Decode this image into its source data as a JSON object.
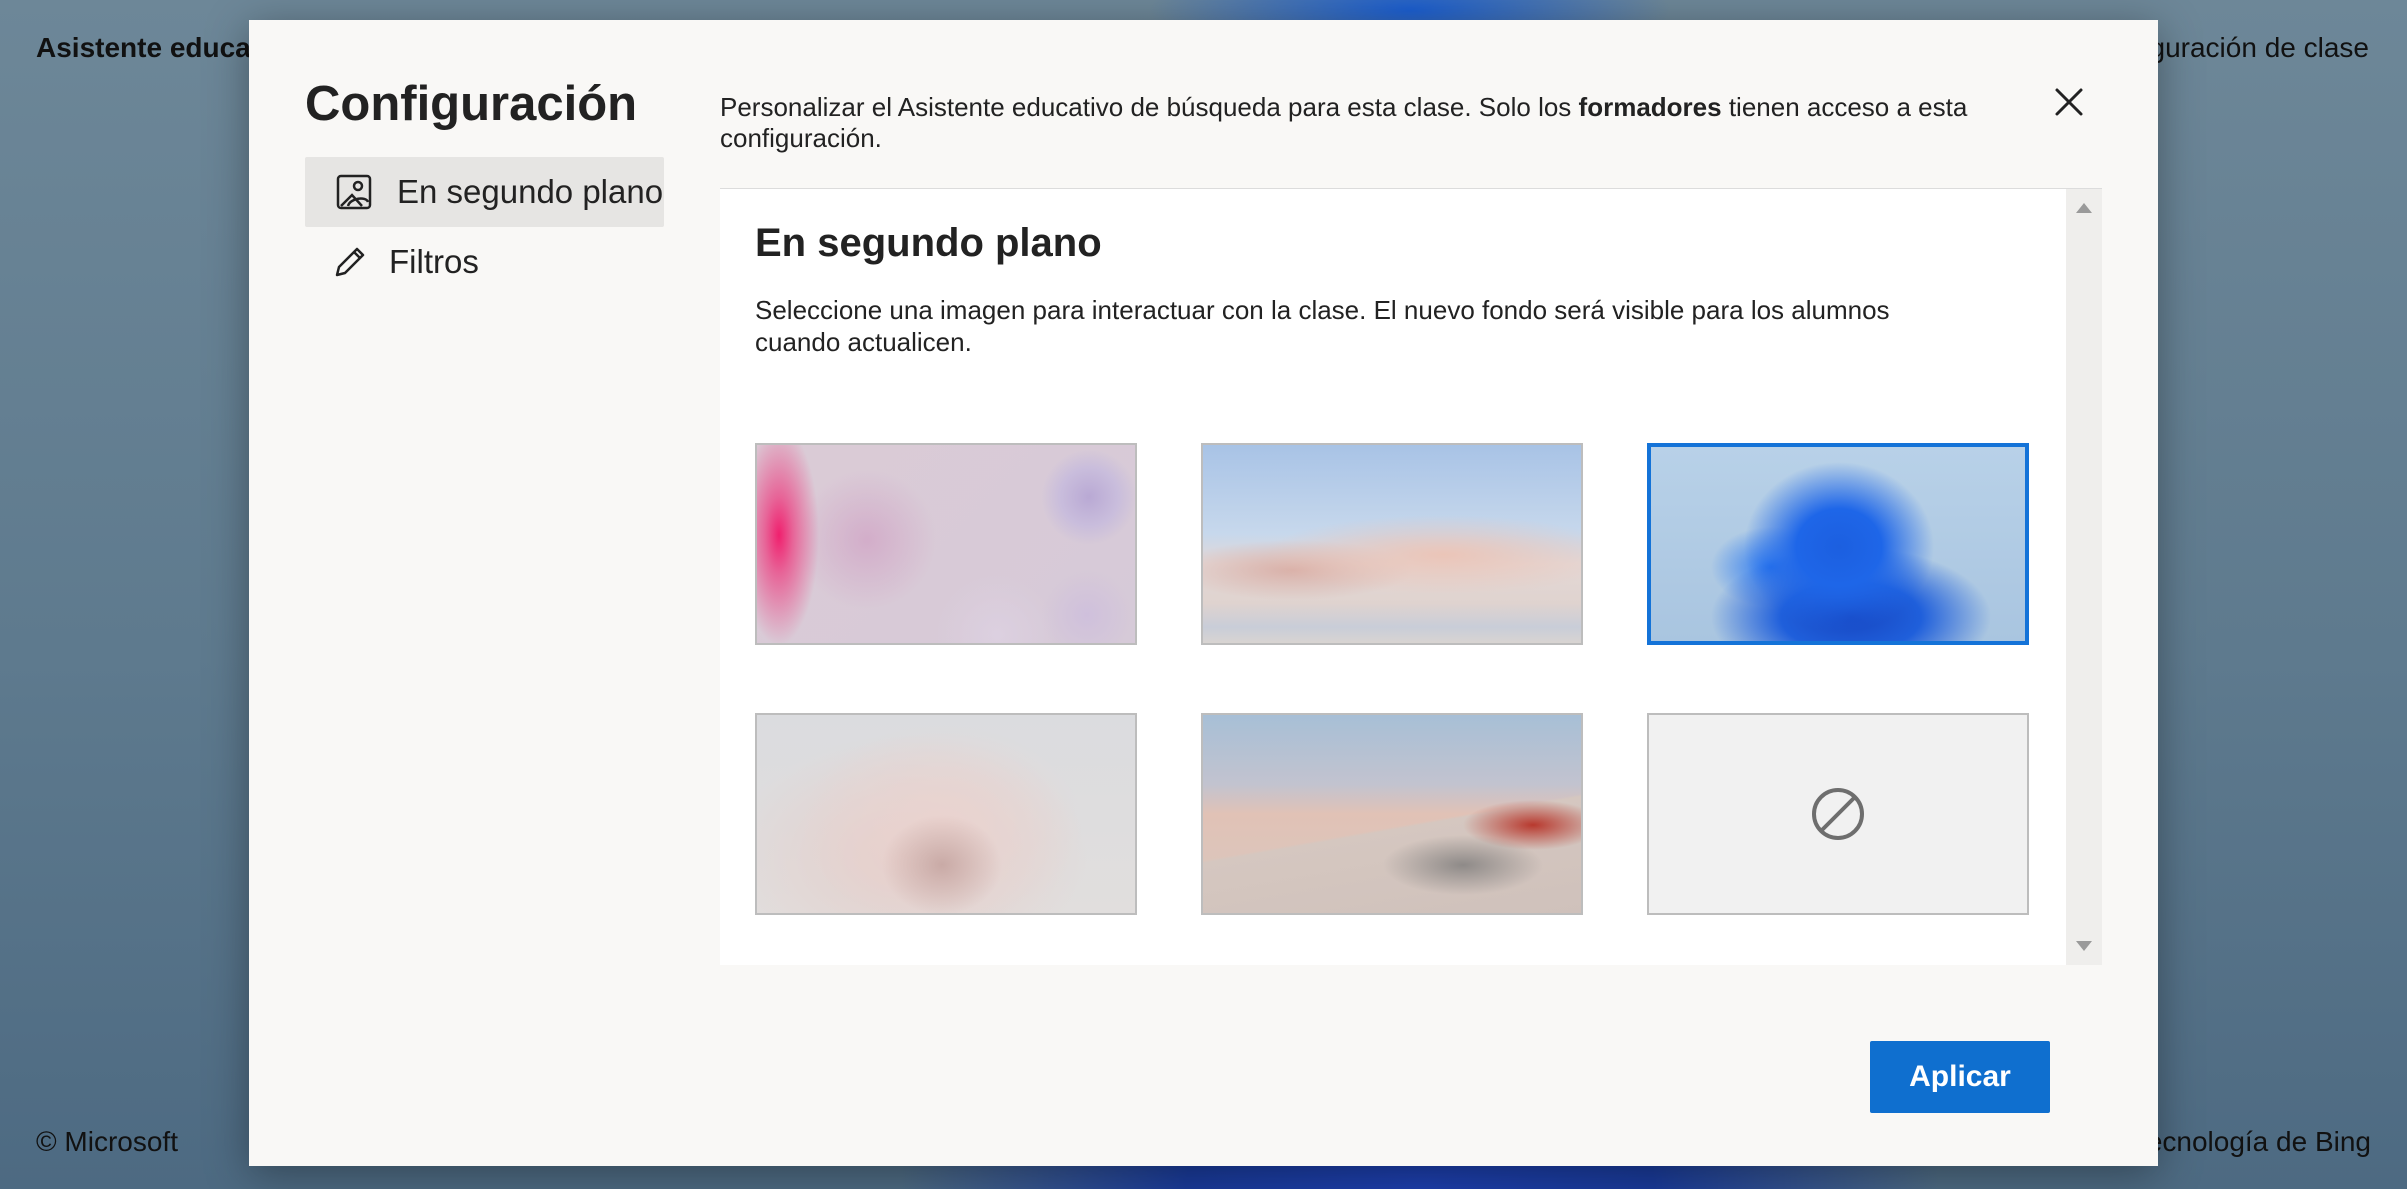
{
  "background": {
    "brand": "Asistente educati",
    "settings_link": "guración de clase",
    "copyright": "© Microsoft",
    "powered_by": "ecnología de Bing"
  },
  "dialog": {
    "title": "Configuración",
    "intro_before": "Personalizar el Asistente educativo de búsqueda para esta clase. Solo los ",
    "intro_bold": "formadores",
    "intro_after": " tienen acceso a esta configuración.",
    "close_icon": "close-icon",
    "nav": [
      {
        "label": "En segundo plano",
        "icon": "image-icon",
        "active": true
      },
      {
        "label": "Filtros",
        "icon": "pencil-icon",
        "active": false
      }
    ],
    "panel": {
      "heading": "En segundo plano",
      "description": "Seleccione una imagen para interactuar con la clase. El nuevo fondo será visible para los alumnos cuando actualicen.",
      "backgrounds": [
        {
          "name": "bubbles-pink",
          "selected": false
        },
        {
          "name": "desert-dunes-blue-sky",
          "selected": false
        },
        {
          "name": "blue-bloom",
          "selected": true
        },
        {
          "name": "pink-flower",
          "selected": false
        },
        {
          "name": "desert-dunes-sunset",
          "selected": false
        },
        {
          "name": "no-background",
          "icon": "prohibited-icon",
          "selected": false
        }
      ]
    },
    "apply_label": "Aplicar"
  },
  "colors": {
    "accent": "#0f6fcf",
    "selected_border": "#1473d8"
  }
}
